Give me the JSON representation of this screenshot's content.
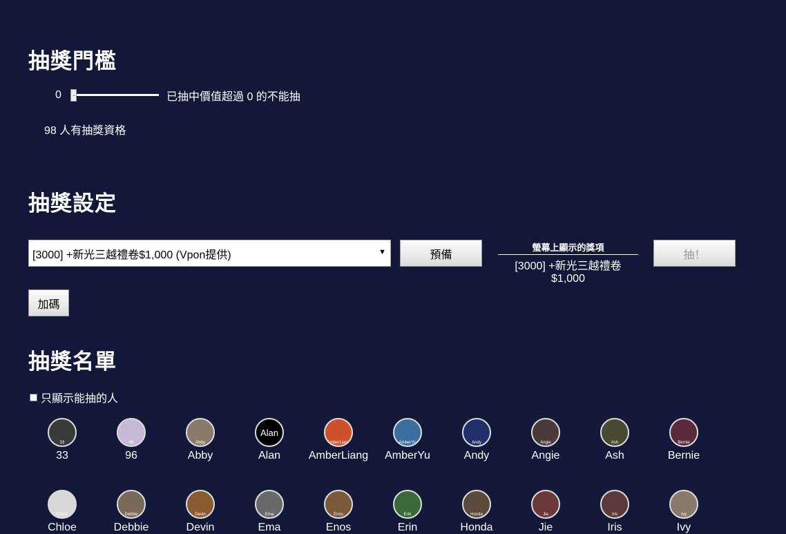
{
  "threshold": {
    "heading": "抽獎門檻",
    "value": "0",
    "slider_fraction": 0,
    "description": "已抽中價值超過 0 的不能抽",
    "eligible": "98 人有抽獎資格"
  },
  "settings": {
    "heading": "抽獎設定",
    "selected_prize": "[3000] +新光三越禮卷$1,000 (Vpon提供)",
    "ready_label": "預備",
    "display_title": "螢幕上顯示的獎項",
    "display_prize": "[3000] +新光三越禮卷$1,000",
    "draw_label": "抽！",
    "bonus_label": "加碼"
  },
  "list": {
    "heading": "抽獎名單",
    "filter_label": "只顯示能抽的人",
    "people": [
      {
        "name": "33",
        "tag": "33",
        "color": "#3a3a3a"
      },
      {
        "name": "96",
        "tag": "96",
        "color": "#c9b7d6"
      },
      {
        "name": "Abby",
        "tag": "Abby",
        "color": "#8a7a6a"
      },
      {
        "name": "Alan",
        "tag": "",
        "text": "Alan",
        "color": "#000000"
      },
      {
        "name": "AmberLiang",
        "tag": "AmberLiang",
        "color": "#d0502a"
      },
      {
        "name": "AmberYu",
        "tag": "AmberYu",
        "color": "#3a6fa0"
      },
      {
        "name": "Andy",
        "tag": "Andy",
        "color": "#20306a"
      },
      {
        "name": "Angie",
        "tag": "Angie",
        "color": "#4a3a3a"
      },
      {
        "name": "Ash",
        "tag": "Ash",
        "color": "#4a4a30"
      },
      {
        "name": "Bernie",
        "tag": "Bernie",
        "color": "#5a2a3a"
      },
      {
        "name": "Chloe",
        "tag": "Chloe",
        "color": "#d8d8d8"
      },
      {
        "name": "Debbie",
        "tag": "Debbie",
        "color": "#7a6a5a"
      },
      {
        "name": "Devin",
        "tag": "Devin",
        "color": "#8a5a30"
      },
      {
        "name": "Ema",
        "tag": "Ema",
        "color": "#6a6a6a"
      },
      {
        "name": "Enos",
        "tag": "Enos",
        "color": "#7a5a3a"
      },
      {
        "name": "Erin",
        "tag": "Erin",
        "color": "#3a6a3a"
      },
      {
        "name": "Honda",
        "tag": "Honda",
        "color": "#5a4a3a"
      },
      {
        "name": "Jie",
        "tag": "Jie",
        "color": "#6a3a3a"
      },
      {
        "name": "Iris",
        "tag": "Iris",
        "color": "#5a3a3a"
      },
      {
        "name": "Ivy",
        "tag": "Ivy",
        "color": "#8a7a6a"
      }
    ]
  }
}
